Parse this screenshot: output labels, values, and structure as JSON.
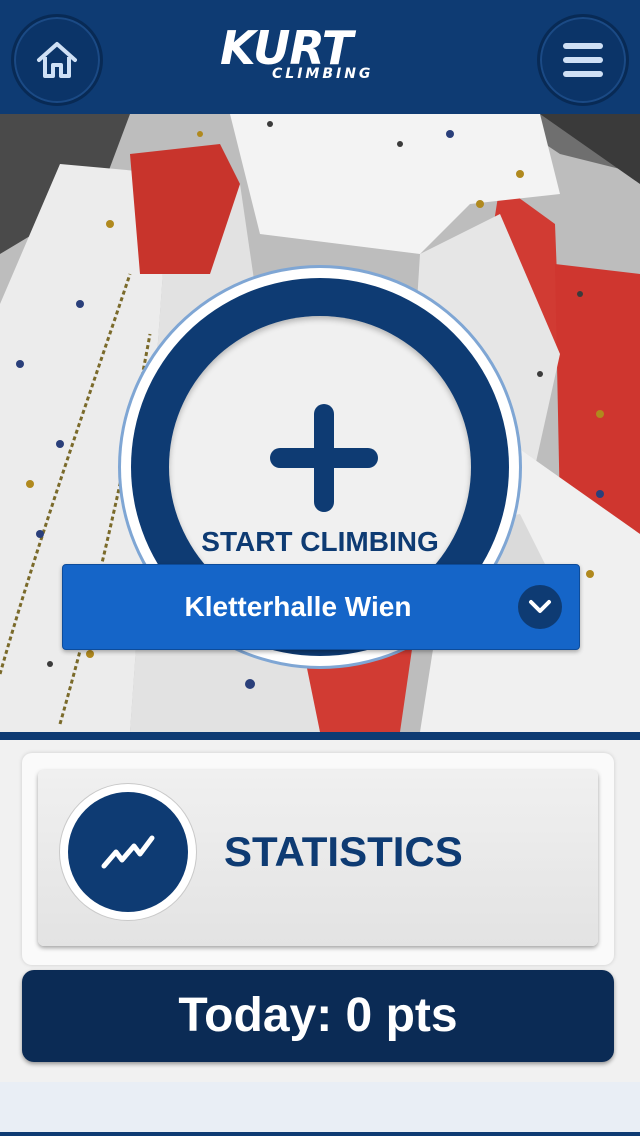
{
  "header": {
    "logo_main": "KURT",
    "logo_sub": "CLIMBING",
    "home_icon": "home-icon",
    "menu_icon": "hamburger-menu-icon"
  },
  "hero": {
    "start_label": "START CLIMBING",
    "start_icon": "plus-icon",
    "location_selected": "Kletterhalle Wien",
    "location_icon": "chevron-down-icon"
  },
  "statistics": {
    "label": "STATISTICS",
    "icon": "trend-line-icon"
  },
  "today": {
    "text": "Today: 0 pts"
  },
  "colors": {
    "primary_navy": "#0e3b73",
    "select_blue": "#1565c8",
    "today_bg": "#0b2b55"
  }
}
